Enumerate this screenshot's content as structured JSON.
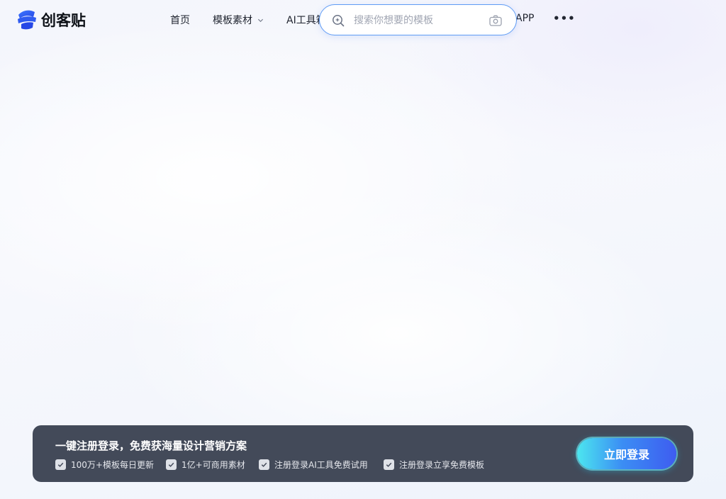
{
  "header": {
    "logo_text": "创客贴",
    "nav": {
      "home": "首页",
      "templates": "模板素材",
      "ai_tools": "AI工具箱",
      "app": "APP",
      "more": "•••"
    },
    "search": {
      "placeholder": "搜索你想要的模板"
    }
  },
  "banner": {
    "title": "一键注册登录，免费获海量设计营销方案",
    "features": [
      "100万+模板每日更新",
      "1亿+可商用素材",
      "注册登录AI工具免费试用",
      "注册登录立享免费模板"
    ],
    "login_button": "立即登录"
  },
  "colors": {
    "brand_blue": "#2f5bf0",
    "banner_bg": "#434a59",
    "search_border": "#5f9cf5"
  }
}
